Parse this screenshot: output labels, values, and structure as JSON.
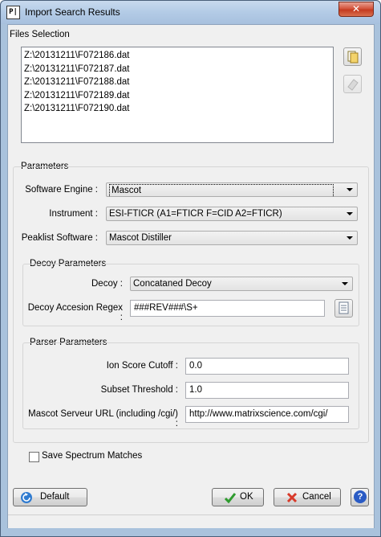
{
  "window": {
    "title": "Import Search Results",
    "app_icon_text": "P|",
    "close_glyph": "✕"
  },
  "files": {
    "section_label": "Files Selection",
    "items": [
      "Z:\\20131211\\F072186.dat",
      "Z:\\20131211\\F072187.dat",
      "Z:\\20131211\\F072188.dat",
      "Z:\\20131211\\F072189.dat",
      "Z:\\20131211\\F072190.dat"
    ],
    "icons": [
      "open-file-icon",
      "eraser-icon"
    ]
  },
  "parameters": {
    "section_label": "Parameters",
    "software_engine_label": "Software Engine :",
    "software_engine_value": "Mascot",
    "instrument_label": "Instrument :",
    "instrument_value": "ESI-FTICR (A1=FTICR F=CID A2=FTICR)",
    "peaklist_label": "Peaklist Software :",
    "peaklist_value": "Mascot Distiller"
  },
  "decoy": {
    "section_label": "Decoy Parameters",
    "decoy_label": "Decoy :",
    "decoy_value": "Concataned Decoy",
    "regex_label": "Decoy Accesion Regex :",
    "regex_value": "###REV###\\S+"
  },
  "parser": {
    "section_label": "Parser Parameters",
    "ion_score_label": "Ion Score Cutoff :",
    "ion_score_value": "0.0",
    "subset_label": "Subset Threshold :",
    "subset_value": "1.0",
    "mascot_url_label": "Mascot Serveur URL (including /cgi/) :",
    "mascot_url_value": "http://www.matrixscience.com/cgi/"
  },
  "options": {
    "save_spectrum_label": "Save Spectrum Matches",
    "save_spectrum_checked": false
  },
  "buttons": {
    "default_label": "Default",
    "ok_label": "OK",
    "cancel_label": "Cancel",
    "help_glyph": "?"
  },
  "colors": {
    "ok_check": "#2e9b2e",
    "cancel_x": "#d83a2a",
    "default_icon": "#2f7bd0",
    "help_bg": "#2a5bc5"
  }
}
